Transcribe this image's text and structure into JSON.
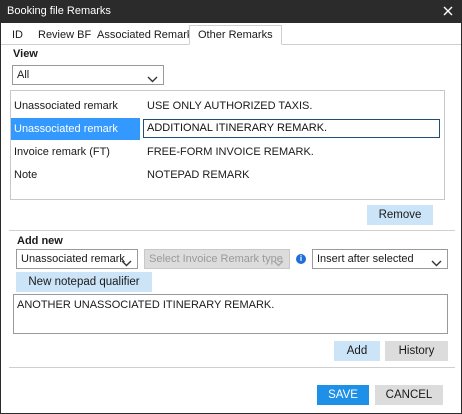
{
  "window": {
    "title": "Booking file Remarks"
  },
  "tabs": [
    {
      "label": "ID"
    },
    {
      "label": "Review BF"
    },
    {
      "label": "Associated Remarks"
    },
    {
      "label": "Other Remarks"
    }
  ],
  "active_tab": "Other Remarks",
  "view": {
    "heading": "View",
    "filter_value": "All"
  },
  "remarks_list": {
    "rows": [
      {
        "type": "Unassociated remark",
        "text": "USE ONLY AUTHORIZED TAXIS.",
        "selected": false
      },
      {
        "type": "Unassociated remark",
        "text": "ADDITIONAL ITINERARY REMARK.",
        "selected": true,
        "editing": true
      },
      {
        "type": "Invoice remark (FT)",
        "text": "FREE-FORM INVOICE REMARK.",
        "selected": false
      },
      {
        "type": "Note",
        "text": "NOTEPAD REMARK",
        "selected": false
      }
    ],
    "selection_color": "#3399ff"
  },
  "remove_button": "Remove",
  "add_new": {
    "heading": "Add new",
    "remark_type_value": "Unassociated remark",
    "invoice_type_placeholder": "Select Invoice Remark type",
    "insert_position_value": "Insert after selected",
    "notepad_qualifier_button": "New notepad qualifier",
    "remark_text": "ANOTHER UNASSOCIATED ITINERARY REMARK.",
    "add_button": "Add",
    "history_button": "History"
  },
  "footer": {
    "save_button": "SAVE",
    "cancel_button": "CANCEL"
  },
  "colors": {
    "titlebar": "#2b2b2b",
    "primary": "#1e90e8",
    "light_button": "#cce4f7",
    "gray_button": "#dcdcdc"
  },
  "icons": {
    "close": "close-icon",
    "dropdown": "chevron-down-icon",
    "info": "info-icon"
  }
}
